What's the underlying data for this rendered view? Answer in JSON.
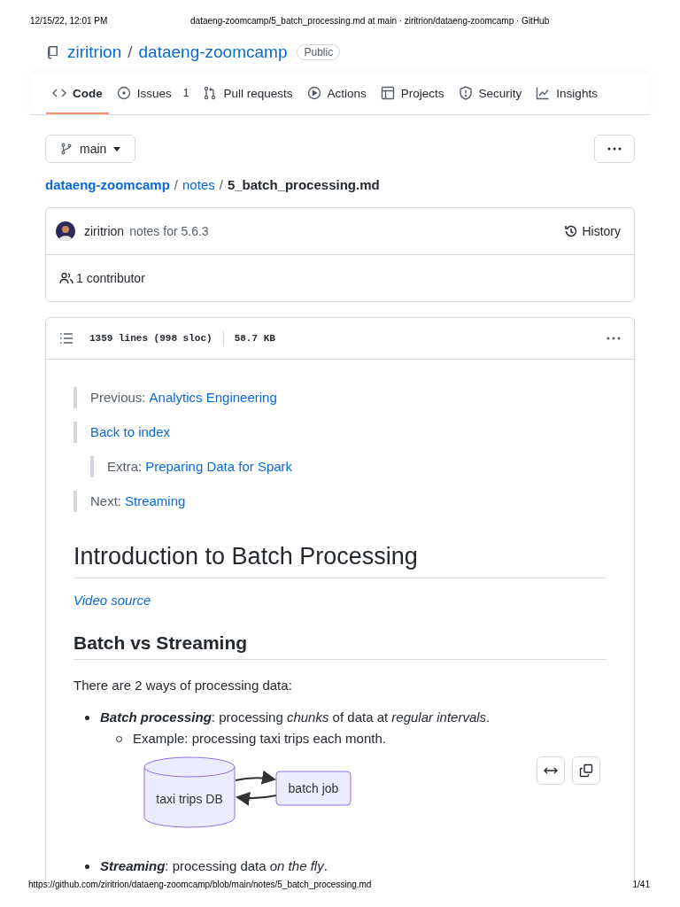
{
  "print_header": {
    "date": "12/15/22, 12:01 PM",
    "title": "dataeng-zoomcamp/5_batch_processing.md at main · ziritrion/dataeng-zoomcamp · GitHub"
  },
  "repo": {
    "owner": "ziritrion",
    "separator": "/",
    "name": "dataeng-zoomcamp",
    "visibility": "Public"
  },
  "tabs": [
    {
      "label": "Code",
      "selected": true
    },
    {
      "label": "Issues",
      "count": "1",
      "selected": false
    },
    {
      "label": "Pull requests",
      "selected": false
    },
    {
      "label": "Actions",
      "selected": false
    },
    {
      "label": "Projects",
      "selected": false
    },
    {
      "label": "Security",
      "selected": false
    },
    {
      "label": "Insights",
      "selected": false
    }
  ],
  "branch": "main",
  "breadcrumb": {
    "links": [
      "dataeng-zoomcamp",
      "notes"
    ],
    "file": "5_batch_processing.md",
    "separators": [
      "/",
      "/"
    ]
  },
  "commit": {
    "author": "ziritrion",
    "message": "notes for 5.6.3",
    "history": "History",
    "contributors": "1 contributor"
  },
  "file_info": {
    "lines": "1359 lines (998 sloc)",
    "size": "58.7 KB"
  },
  "nav_quotes": [
    {
      "label": "Previous:",
      "link": "Analytics Engineering"
    },
    {
      "link": "Back to index",
      "children": [
        {
          "label": "Extra:",
          "link": "Preparing Data for Spark"
        }
      ]
    },
    {
      "label": "Next:",
      "link": "Streaming"
    }
  ],
  "h1": "Introduction to Batch Processing",
  "video_link": "Video source",
  "h2": "Batch vs Streaming",
  "intro": "There are 2 ways of processing data:",
  "bullets": [
    {
      "term": "Batch processing",
      "text": ": processing *chunks* of data at *regular intervals*.",
      "children": [
        "Example: processing taxi trips each month."
      ],
      "diagram": {
        "nodes": [
          {
            "label": "taxi trips DB",
            "kind": "database"
          },
          {
            "label": "batch job",
            "kind": "process"
          }
        ]
      }
    },
    {
      "term": "Streaming",
      "text": ": processing data *on the fly*."
    }
  ],
  "footer": {
    "url": "https://github.com/ziritrion/dataeng-zoomcamp/blob/main/notes/5_batch_processing.md",
    "page": "1/41"
  }
}
